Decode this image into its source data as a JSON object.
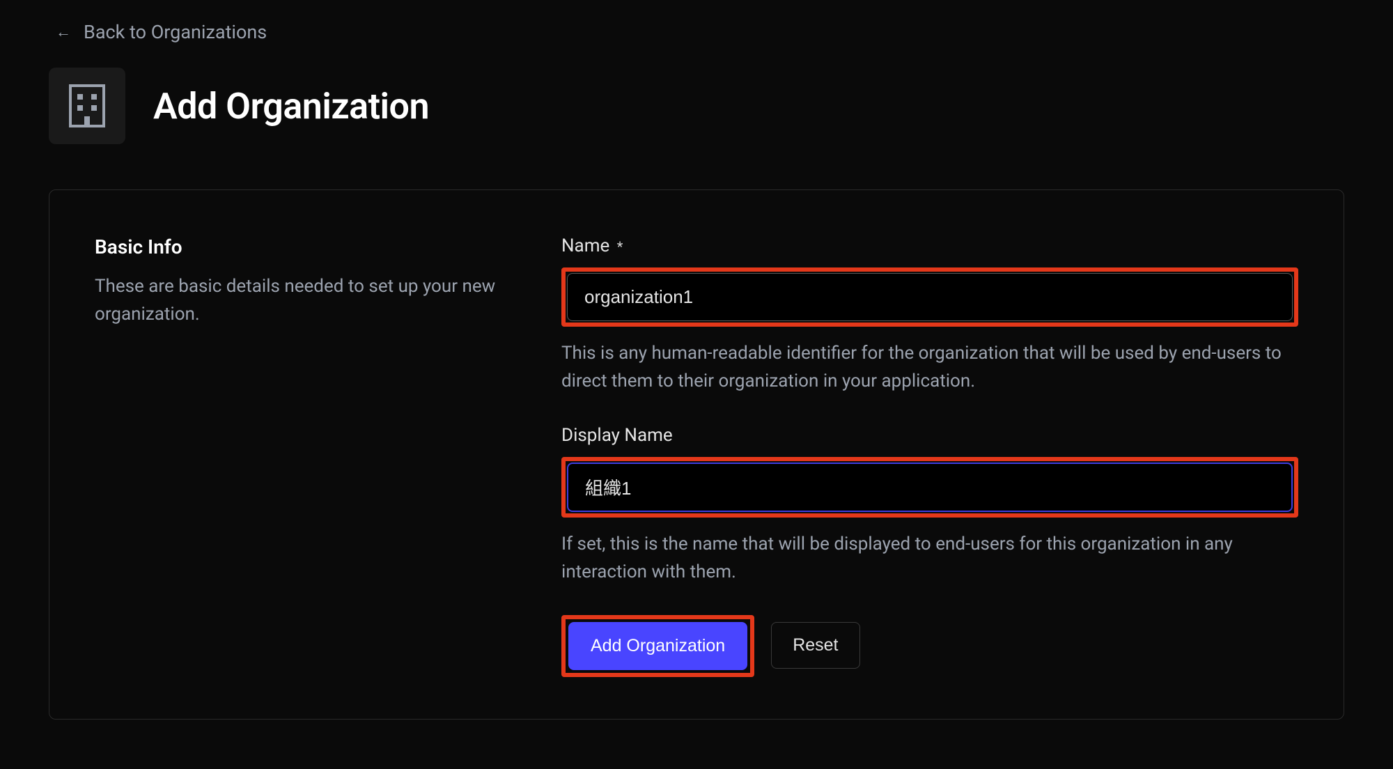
{
  "back_link": {
    "label": "Back to Organizations"
  },
  "header": {
    "title": "Add Organization"
  },
  "section": {
    "title": "Basic Info",
    "description": "These are basic details needed to set up your new organization."
  },
  "fields": {
    "name": {
      "label": "Name",
      "required_marker": "*",
      "value": "organization1",
      "help": "This is any human-readable identifier for the organization that will be used by end-users to direct them to their organization in your application."
    },
    "display_name": {
      "label": "Display Name",
      "value": "組織1",
      "help": "If set, this is the name that will be displayed to end-users for this organization in any interaction with them."
    }
  },
  "actions": {
    "submit_label": "Add Organization",
    "reset_label": "Reset"
  }
}
